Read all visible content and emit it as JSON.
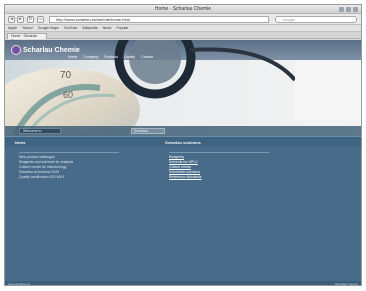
{
  "window": {
    "title": "Home · Scharlau Chemie"
  },
  "navbar": {
    "back_label": "◂",
    "forward_label": "▸",
    "reload_label": "↻",
    "home_label": "⌂",
    "url": "http://www.scharlau.es/web/de/home.html",
    "search_placeholder": "Google"
  },
  "bookmarks": [
    "Apple",
    "Yahoo!",
    "Google Maps",
    "YouTube",
    "Wikipedia",
    "News",
    "Popular"
  ],
  "tabs": [
    {
      "label": "Home · Scharlau Chemie"
    }
  ],
  "site": {
    "logo_text": "Scharlau Chemie",
    "nav": [
      "Home",
      "Company",
      "Products",
      "Quality",
      "Contact"
    ],
    "welcome_label": "Welcome to",
    "mini_label": "Scharlau",
    "left_heading": "News",
    "right_heading": "Scharlau solutions",
    "left_lines": [
      "New product catalogue",
      "Reagents and solvents for analysis",
      "Culture media for microbiology",
      "Scharlau at Achema 2009",
      "Quality certification ISO 9001"
    ],
    "right_lines": [
      "Reagents",
      "Solvents for HPLC",
      "Culture media",
      "Volumetric solutions",
      "Reference standards"
    ],
    "footer_left": "www.scharlau.es",
    "footer_right": "Scharlau Chemie"
  },
  "hero": {
    "dial_text_1": "70",
    "dial_text_2": "60"
  },
  "colors": {
    "accent": "#7a4fa6",
    "page_bg": "#4f7390",
    "header_bg": "#3f6482"
  }
}
